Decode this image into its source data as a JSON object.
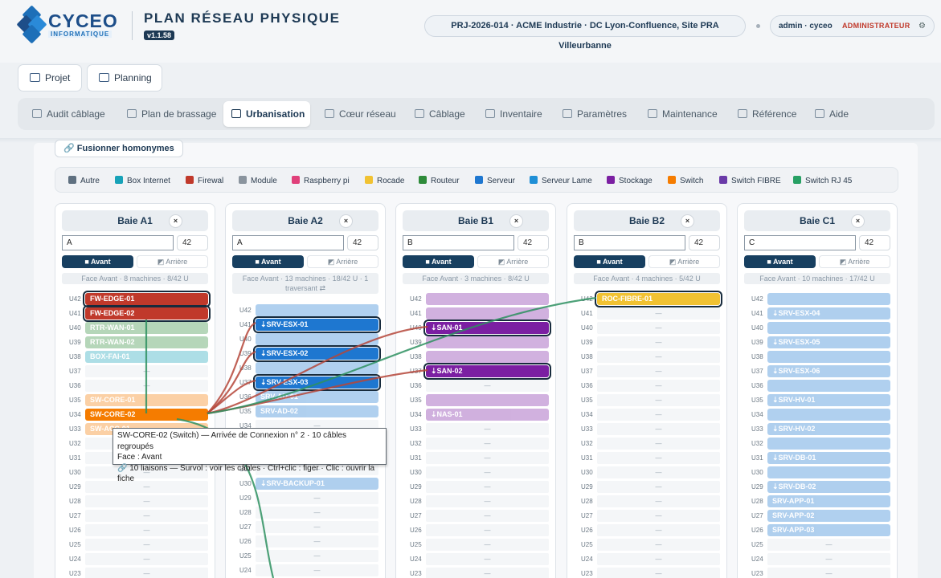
{
  "header": {
    "brand_main": "CYCEO",
    "brand_sub": "INFORMATIQUE",
    "title": "PLAN RÉSEAU PHYSIQUE",
    "version": "v1.1.58",
    "project": "PRJ-2026-014 · ACME Industrie · DC Lyon-Confluence, Site PRA Villeurbanne",
    "user": "admin · cyceo",
    "role": "ADMINISTRATEUR",
    "settings_icon": "gear-icon"
  },
  "top_buttons": [
    {
      "label": "Projet",
      "icon": "folder-icon"
    },
    {
      "label": "Planning",
      "icon": "calendar-icon"
    }
  ],
  "tabs": [
    {
      "label": "Audit câblage",
      "icon": "audit-icon"
    },
    {
      "label": "Plan de brassage",
      "icon": "patch-plan-icon"
    },
    {
      "label": "Urbanisation",
      "icon": "rack-icon",
      "active": true
    },
    {
      "label": "Cœur réseau",
      "icon": "network-core-icon"
    },
    {
      "label": "Câblage",
      "icon": "cable-icon"
    },
    {
      "label": "Inventaire",
      "icon": "inventory-icon"
    },
    {
      "label": "Paramètres",
      "icon": "gear-icon"
    },
    {
      "label": "Maintenance",
      "icon": "maintenance-icon"
    },
    {
      "label": "Référence",
      "icon": "reference-icon"
    },
    {
      "label": "Aide",
      "icon": "help-icon"
    }
  ],
  "merge_button": "Fusionner homonymes",
  "legend": [
    {
      "label": "Autre",
      "color": "#5f7080"
    },
    {
      "label": "Box Internet",
      "color": "#17a2b8"
    },
    {
      "label": "Firewal",
      "color": "#c0392b"
    },
    {
      "label": "Module",
      "color": "#8a949e"
    },
    {
      "label": "Raspberry pi",
      "color": "#e0407a"
    },
    {
      "label": "Rocade",
      "color": "#f1c232"
    },
    {
      "label": "Routeur",
      "color": "#2e8b3a"
    },
    {
      "label": "Serveur",
      "color": "#1e77d0"
    },
    {
      "label": "Serveur Lame",
      "color": "#1f8fd6"
    },
    {
      "label": "Stockage",
      "color": "#7b1fa2"
    },
    {
      "label": "Switch",
      "color": "#f57c00"
    },
    {
      "label": "Switch FIBRE",
      "color": "#6a3aa8"
    },
    {
      "label": "Switch RJ 45",
      "color": "#27a064"
    }
  ],
  "racks": [
    {
      "title": "Baie A1",
      "name": "A",
      "height": "42",
      "front": "Avant",
      "back": "Arrière",
      "info": "Face Avant · 8 machines · 8/42 U",
      "devices": [
        {
          "u": 42,
          "label": "FW-EDGE-01",
          "color": "#c0392b",
          "sel": true
        },
        {
          "u": 41,
          "label": "FW-EDGE-02",
          "color": "#c0392b",
          "sel": true
        },
        {
          "u": 40,
          "label": "RTR-WAN-01",
          "color": "#2e8b3a",
          "faded": true
        },
        {
          "u": 39,
          "label": "RTR-WAN-02",
          "color": "#2e8b3a",
          "faded": true
        },
        {
          "u": 38,
          "label": "BOX-FAI-01",
          "color": "#17a2b8",
          "faded": true
        },
        {
          "u": 35,
          "label": "SW-CORE-01",
          "color": "#f57c00",
          "faded": true
        },
        {
          "u": 34,
          "label": "SW-CORE-02",
          "color": "#f57c00"
        },
        {
          "u": 33,
          "label": "SW-ACC-01",
          "color": "#f57c00",
          "faded": true
        }
      ]
    },
    {
      "title": "Baie A2",
      "name": "A",
      "height": "42",
      "front": "Avant",
      "back": "Arrière",
      "info": "Face Avant · 13 machines · 18/42 U · 1 traversant ⇄",
      "devices": [
        {
          "u": 42,
          "label": "",
          "color": "#1e77d0",
          "faded": true
        },
        {
          "u": 41,
          "label": "⇣SRV-ESX-01",
          "color": "#1e77d0",
          "sel": true
        },
        {
          "u": 40,
          "label": "",
          "color": "#1e77d0",
          "faded": true
        },
        {
          "u": 39,
          "label": "⇣SRV-ESX-02",
          "color": "#1e77d0",
          "sel": true
        },
        {
          "u": 38,
          "label": "",
          "color": "#1e77d0",
          "faded": true
        },
        {
          "u": 37,
          "label": "⇣SRV-ESX-03",
          "color": "#1e77d0",
          "sel": true
        },
        {
          "u": 36,
          "label": "SRV-AD-01",
          "color": "#1e77d0",
          "faded": true
        },
        {
          "u": 35,
          "label": "SRV-AD-02",
          "color": "#1e77d0",
          "faded": true
        },
        {
          "u": 30,
          "label": "⇣SRV-BACKUP-01",
          "color": "#1e77d0",
          "faded": true
        }
      ]
    },
    {
      "title": "Baie B1",
      "name": "B",
      "height": "42",
      "front": "Avant",
      "back": "Arrière",
      "info": "Face Avant · 3 machines · 8/42 U",
      "devices": [
        {
          "u": 42,
          "label": "",
          "color": "#7b1fa2",
          "faded": true
        },
        {
          "u": 41,
          "label": "",
          "color": "#7b1fa2",
          "faded": true
        },
        {
          "u": 40,
          "label": "⇣SAN-01",
          "color": "#7b1fa2",
          "sel": true
        },
        {
          "u": 39,
          "label": "",
          "color": "#7b1fa2",
          "faded": true
        },
        {
          "u": 38,
          "label": "",
          "color": "#7b1fa2",
          "faded": true
        },
        {
          "u": 37,
          "label": "⇣SAN-02",
          "color": "#7b1fa2",
          "sel": true
        },
        {
          "u": 35,
          "label": "",
          "color": "#7b1fa2",
          "faded": true
        },
        {
          "u": 34,
          "label": "⇣NAS-01",
          "color": "#7b1fa2",
          "faded": true
        }
      ]
    },
    {
      "title": "Baie B2",
      "name": "B",
      "height": "42",
      "front": "Avant",
      "back": "Arrière",
      "info": "Face Avant · 4 machines · 5/42 U",
      "devices": [
        {
          "u": 42,
          "label": "ROC-FIBRE-01",
          "color": "#f1c232",
          "sel": true
        }
      ]
    },
    {
      "title": "Baie C1",
      "name": "C",
      "height": "42",
      "front": "Avant",
      "back": "Arrière",
      "info": "Face Avant · 10 machines · 17/42 U",
      "devices": [
        {
          "u": 42,
          "label": "",
          "color": "#1e77d0",
          "faded": true
        },
        {
          "u": 41,
          "label": "⇣SRV-ESX-04",
          "color": "#1e77d0",
          "faded": true
        },
        {
          "u": 40,
          "label": "",
          "color": "#1e77d0",
          "faded": true
        },
        {
          "u": 39,
          "label": "⇣SRV-ESX-05",
          "color": "#1e77d0",
          "faded": true
        },
        {
          "u": 38,
          "label": "",
          "color": "#1e77d0",
          "faded": true
        },
        {
          "u": 37,
          "label": "⇣SRV-ESX-06",
          "color": "#1e77d0",
          "faded": true
        },
        {
          "u": 36,
          "label": "",
          "color": "#1e77d0",
          "faded": true
        },
        {
          "u": 35,
          "label": "⇣SRV-HV-01",
          "color": "#1e77d0",
          "faded": true
        },
        {
          "u": 34,
          "label": "",
          "color": "#1e77d0",
          "faded": true
        },
        {
          "u": 33,
          "label": "⇣SRV-HV-02",
          "color": "#1e77d0",
          "faded": true
        },
        {
          "u": 32,
          "label": "",
          "color": "#1e77d0",
          "faded": true
        },
        {
          "u": 31,
          "label": "⇣SRV-DB-01",
          "color": "#1e77d0",
          "faded": true
        },
        {
          "u": 30,
          "label": "",
          "color": "#1e77d0",
          "faded": true
        },
        {
          "u": 29,
          "label": "⇣SRV-DB-02",
          "color": "#1e77d0",
          "faded": true
        },
        {
          "u": 28,
          "label": "SRV-APP-01",
          "color": "#1e77d0",
          "faded": true
        },
        {
          "u": 27,
          "label": "SRV-APP-02",
          "color": "#1e77d0",
          "faded": true
        },
        {
          "u": 26,
          "label": "SRV-APP-03",
          "color": "#1e77d0",
          "faded": true
        }
      ]
    }
  ],
  "empty_slot_label": "—",
  "tooltip": {
    "line1": "SW-CORE-02 (Switch) — Arrivée de Connexion n° 2 · 10 câbles regroupés",
    "line2": "Face : Avant",
    "line3": "🔗 10 liaisons — Survol : voir les câbles · Ctrl+clic : figer · Clic : ouvrir la fiche"
  },
  "cable_colors": {
    "red": "#b5473a",
    "green": "#2e9060"
  }
}
